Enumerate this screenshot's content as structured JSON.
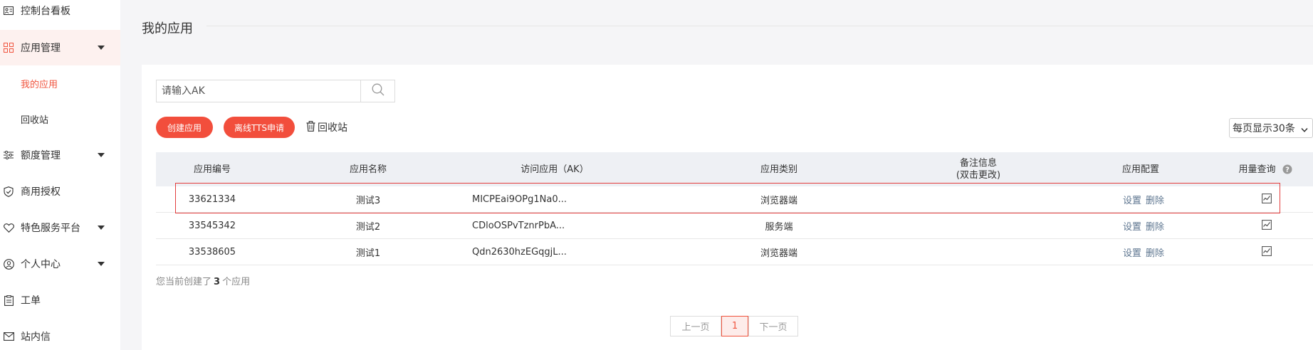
{
  "sidebar": {
    "items": [
      {
        "label": "控制台看板",
        "icon": "id-card-icon"
      },
      {
        "label": "应用管理",
        "icon": "grid-icon"
      },
      {
        "label": "我的应用"
      },
      {
        "label": "回收站"
      },
      {
        "label": "额度管理",
        "icon": "sliders-icon"
      },
      {
        "label": "商用授权",
        "icon": "shield-check-icon"
      },
      {
        "label": "特色服务平台",
        "icon": "heart-icon"
      },
      {
        "label": "个人中心",
        "icon": "user-icon"
      },
      {
        "label": "工单",
        "icon": "clipboard-icon"
      },
      {
        "label": "站内信",
        "icon": "mail-icon"
      }
    ]
  },
  "main": {
    "title": "我的应用",
    "search": {
      "placeholder": "请输入AK",
      "value": ""
    },
    "buttons": {
      "create": "创建应用",
      "offline_tts": "离线TTS申请",
      "recycle": "回收站"
    },
    "page_size": "每页显示30条",
    "table": {
      "headers": {
        "id": "应用编号",
        "name": "应用名称",
        "ak": "访问应用（AK）",
        "type": "应用类别",
        "note_line1": "备注信息",
        "note_line2": "(双击更改)",
        "config": "应用配置",
        "usage": "用量查询"
      },
      "actions": {
        "settings": "设置",
        "delete": "删除"
      },
      "rows": [
        {
          "id": "33621334",
          "name": "测试3",
          "ak": "MICPEai9OPg1Na0...",
          "type": "浏览器端",
          "note": ""
        },
        {
          "id": "33545342",
          "name": "测试2",
          "ak": "CDloOSPvTznrPbA...",
          "type": "服务端",
          "note": ""
        },
        {
          "id": "33538605",
          "name": "测试1",
          "ak": "Qdn2630hzEGqgjL...",
          "type": "浏览器端",
          "note": ""
        }
      ]
    },
    "summary": {
      "prefix": "您当前创建了",
      "count": "3",
      "suffix": "个应用"
    },
    "pagination": {
      "prev": "上一页",
      "current": "1",
      "next": "下一页"
    }
  },
  "colors": {
    "accent": "#f24e3c",
    "link": "#5e7690",
    "highlight_border": "#e33d3d"
  }
}
